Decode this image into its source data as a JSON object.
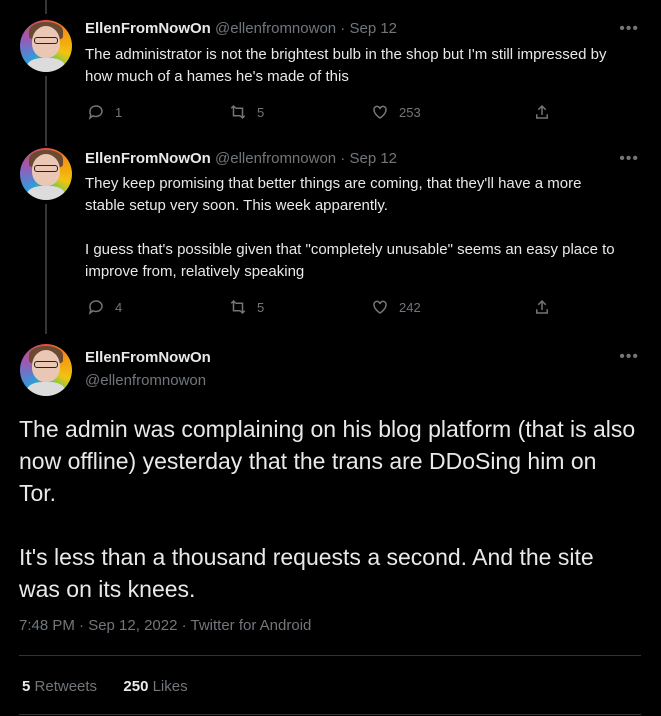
{
  "tweets": [
    {
      "name": "EllenFromNowOn",
      "handle": "@ellenfromnowon",
      "sep": " · ",
      "date": "Sep 12",
      "text": "The administrator is not the brightest bulb in the shop but I'm still impressed by how much of a hames he's made of this",
      "replies": "1",
      "retweets": "5",
      "likes": "253"
    },
    {
      "name": "EllenFromNowOn",
      "handle": "@ellenfromnowon",
      "sep": " · ",
      "date": "Sep 12",
      "text": "They keep promising that better things are coming, that they'll have a more stable setup very soon. This week apparently.\n\nI guess that's possible given that \"completely unusable\" seems an easy place to improve from, relatively speaking",
      "replies": "4",
      "retweets": "5",
      "likes": "242"
    }
  ],
  "main": {
    "name": "EllenFromNowOn",
    "handle": "@ellenfromnowon",
    "text": "The admin was complaining on his blog platform (that is also now offline) yesterday that the trans are DDoSing him on Tor.\n\nIt's less than a thousand requests a second. And the site was on its knees.",
    "meta": "7:48 PM · Sep 12, 2022 · Twitter for Android",
    "retweets_count": "5",
    "retweets_label": "Retweets",
    "likes_count": "250",
    "likes_label": "Likes"
  },
  "more_label": "•••",
  "icons": [
    "reply-icon",
    "retweet-icon",
    "like-icon",
    "share-icon",
    "more-icon"
  ]
}
